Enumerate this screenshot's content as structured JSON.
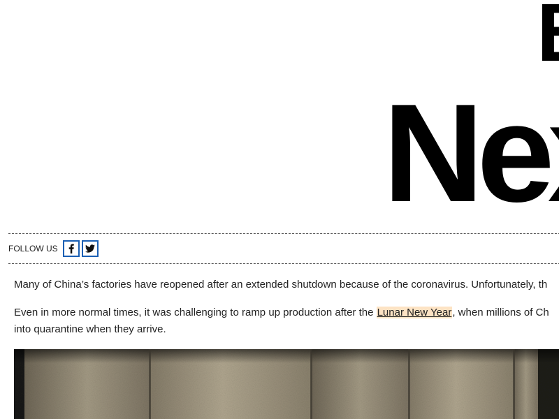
{
  "hero": {
    "line1": "B",
    "line2": "Nex"
  },
  "follow": {
    "label": "FOLLOW US",
    "facebook_icon": "facebook-icon",
    "twitter_icon": "twitter-icon",
    "accent": "#1a5fb4"
  },
  "article": {
    "p1": "Many of China’s factories have reopened after an extended shutdown because of the coronavirus. Unfortunately, th",
    "p2_before": "Even in more normal times, it was challenging to ramp up production after the ",
    "p2_link": "Lunar New Year",
    "p2_after": ", when millions of Ch",
    "p2_line2": "into quarantine when they arrive."
  }
}
